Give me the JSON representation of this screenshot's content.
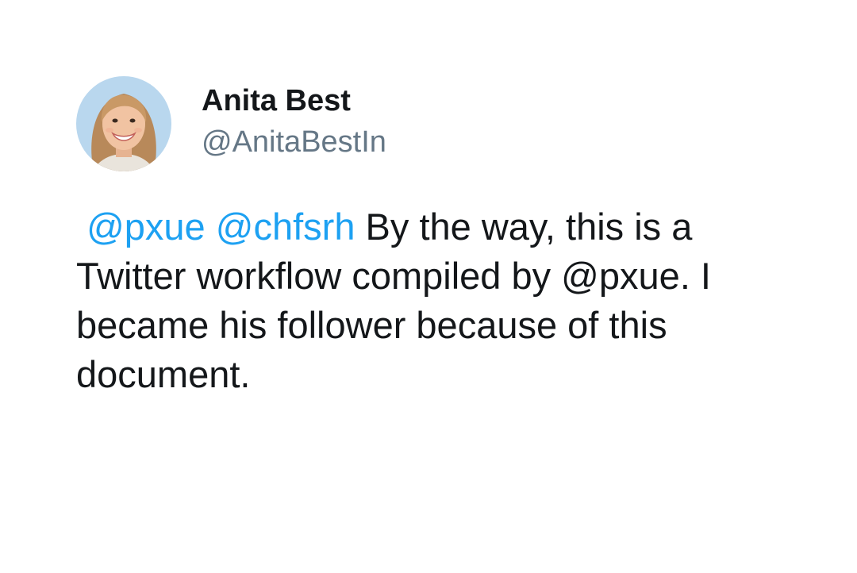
{
  "author": {
    "display_name": "Anita Best",
    "handle": "@AnitaBestIn"
  },
  "tweet": {
    "mentions": [
      "@pxue",
      "@chfsrh"
    ],
    "text": "By the way, this is a Twitter workflow compiled by @pxue. I became his follower because of this document."
  },
  "colors": {
    "mention": "#1da1f2",
    "handle": "#657786",
    "text": "#14171a",
    "background": "#ffffff"
  },
  "icons": {
    "avatar": "profile-photo"
  }
}
